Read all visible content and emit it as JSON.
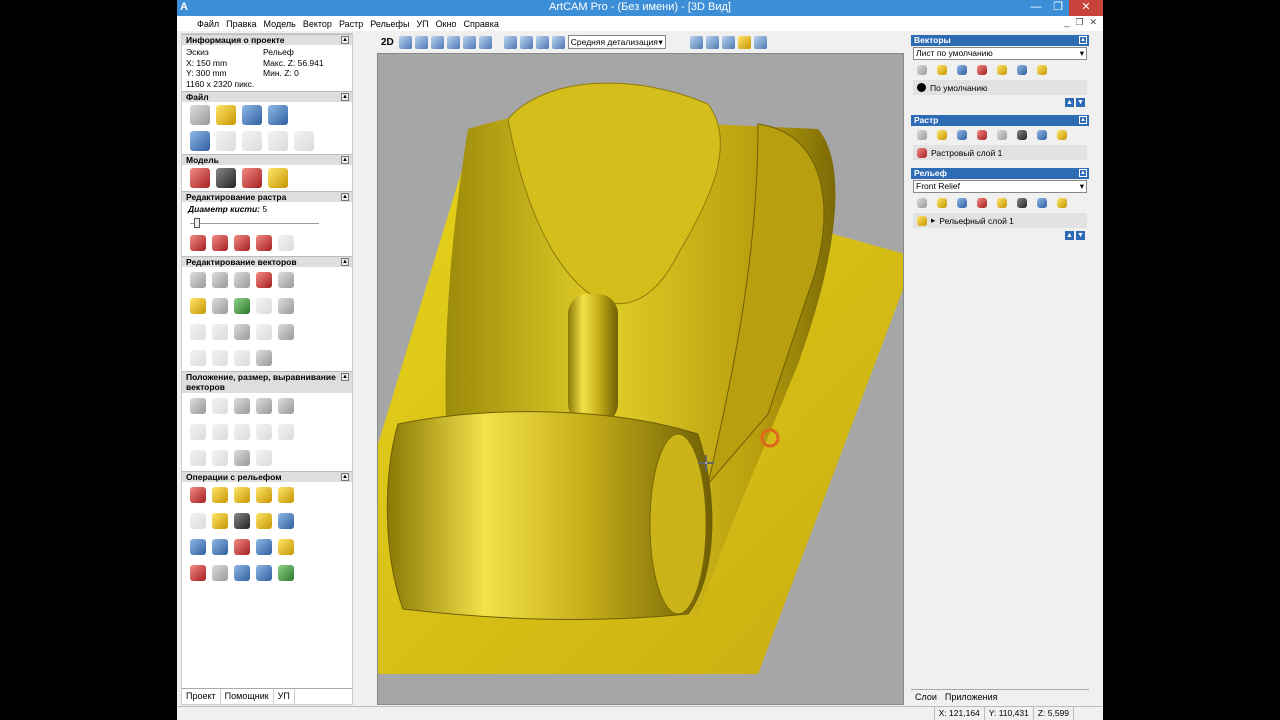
{
  "window": {
    "title": "ArtCAM Pro - (Без имени) - [3D Вид]",
    "app_icon": "artcam-icon",
    "minimize": "—",
    "restore": "❐",
    "close": "✕"
  },
  "menu": [
    "Файл",
    "Правка",
    "Модель",
    "Вектор",
    "Растр",
    "Рельефы",
    "УП",
    "Окно",
    "Справка"
  ],
  "menu_right": [
    "_",
    "❐",
    "✕"
  ],
  "project_info": {
    "header": "Информация о проекте",
    "sketch_label": "Эскиз",
    "relief_label": "Рельеф",
    "x": "X: 150 mm",
    "max_z": "Макс. Z: 56.941",
    "y": "Y: 300 mm",
    "min_z": "Мин. Z: 0",
    "size": "1160 x 2320 пикс."
  },
  "sections": {
    "file": "Файл",
    "model": "Модель",
    "raster_edit": "Редактирование растра",
    "vector_edit": "Редактирование векторов",
    "position": "Положение, размер, выравнивание векторов",
    "relief_ops": "Операции с рельефом"
  },
  "brush": {
    "label": "Диаметр кисти:",
    "value": "5"
  },
  "left_tabs": [
    "Проект",
    "Помощник",
    "УП"
  ],
  "toolbar": {
    "mode": "2D",
    "detail": "Средняя детализация"
  },
  "right": {
    "vectors": {
      "header": "Векторы",
      "sheet": "Лист по умолчанию",
      "layer": "По умолчанию"
    },
    "raster": {
      "header": "Растр",
      "layer": "Растровый слой 1"
    },
    "relief": {
      "header": "Рельеф",
      "select": "Front Relief",
      "layer": "Рельефный слой 1"
    },
    "tabs": [
      "Слои",
      "Приложения"
    ]
  },
  "status": {
    "x": "X: 121,164",
    "y": "Y: 110,431",
    "z": "Z: 5,599"
  },
  "colors": {
    "titlebar": "#3c8fd6",
    "relief_gold": "#d8c21a",
    "panel_header": "#2e6bb5"
  }
}
